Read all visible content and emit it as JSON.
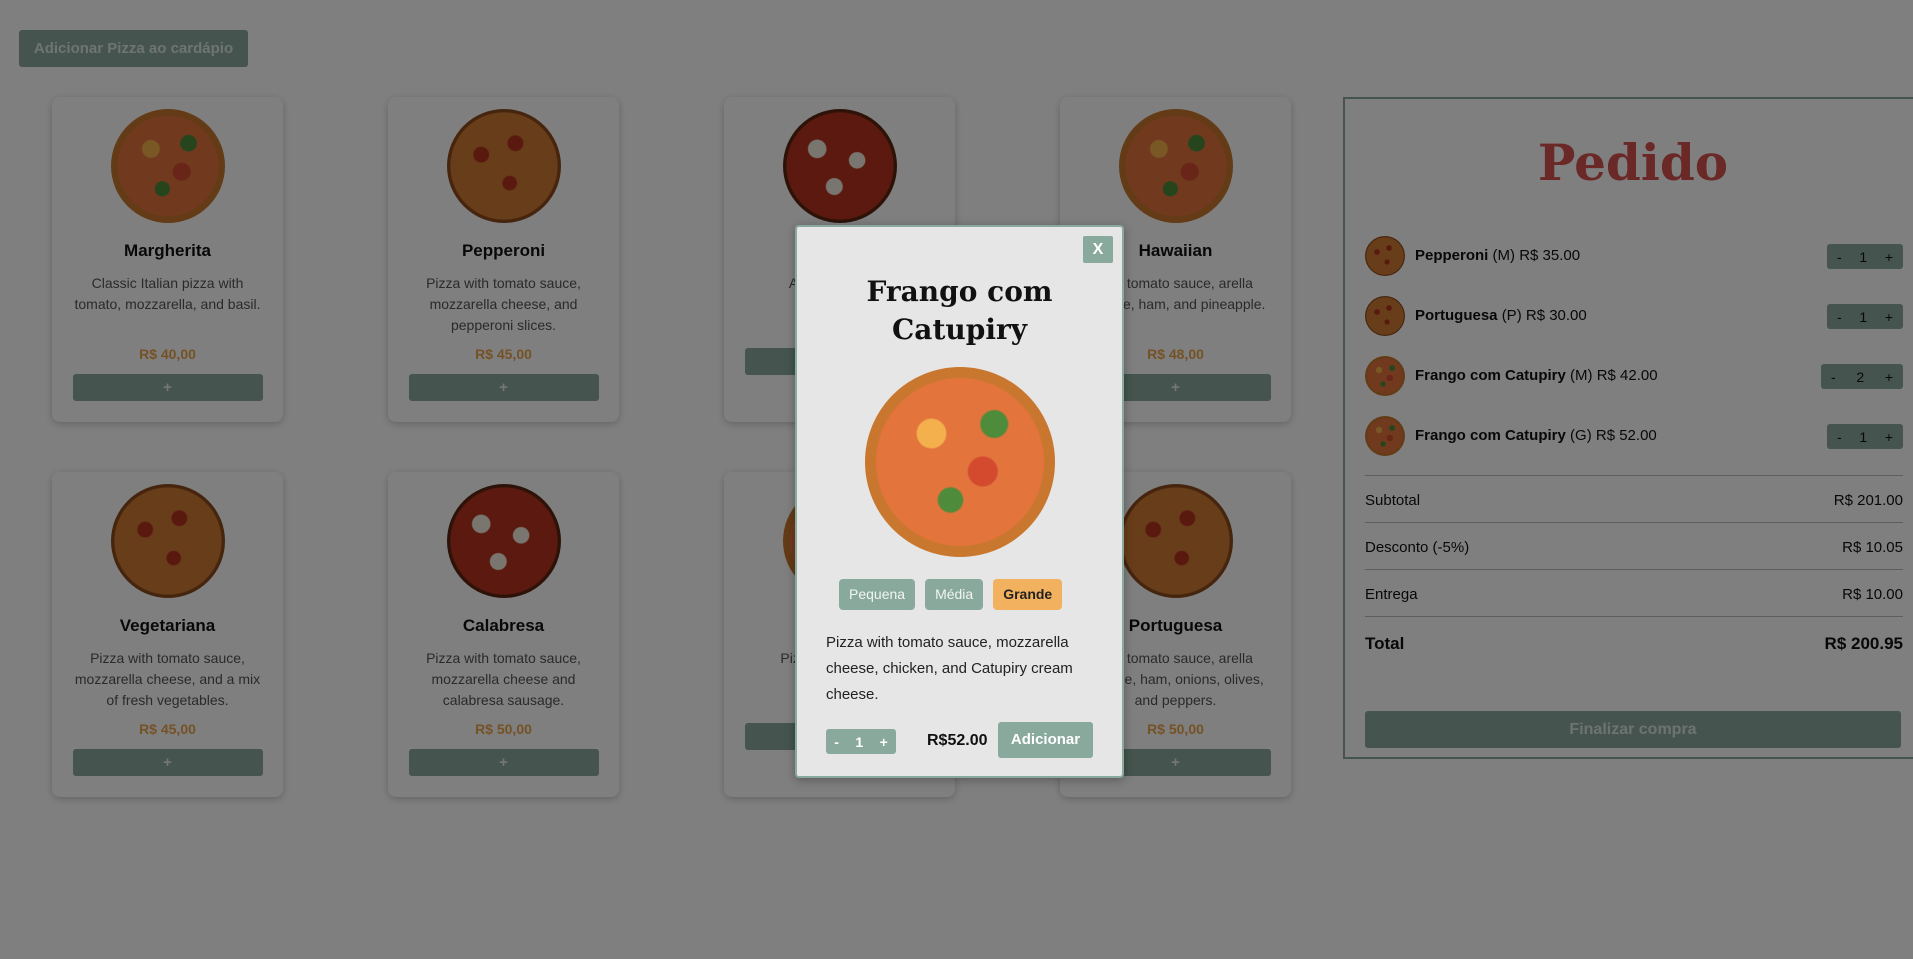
{
  "toolbar": {
    "add_pizza_label": "Adicionar Pizza ao cardápio"
  },
  "menu": [
    {
      "name": "Margherita",
      "desc": "Classic Italian pizza with tomato, mozzarella, and basil.",
      "price": "R$ 40,00",
      "add": "+"
    },
    {
      "name": "Pepperoni",
      "desc": "Pizza with tomato sauce, mozzarella cheese, and pepperoni slices.",
      "price": "R$ 45,00",
      "add": "+"
    },
    {
      "name": "Qua",
      "desc": "A co che parm a",
      "price": "",
      "add": "+"
    },
    {
      "name": "Hawaiian",
      "desc": "with tomato sauce, arella cheese, ham, and pineapple.",
      "price": "R$ 48,00",
      "add": "+"
    },
    {
      "name": "Vegetariana",
      "desc": "Pizza with tomato sauce, mozzarella cheese, and a mix of fresh vegetables.",
      "price": "R$ 45,00",
      "add": "+"
    },
    {
      "name": "Calabresa",
      "desc": "Pizza with tomato sauce, mozzarella cheese and calabresa sausage.",
      "price": "R$ 50,00",
      "add": "+"
    },
    {
      "name": "Frang",
      "desc": "Pizza w mo chick c",
      "price": "",
      "add": "+"
    },
    {
      "name": "Portuguesa",
      "desc": "with tomato sauce, arella cheese, ham, onions, olives, and peppers.",
      "price": "R$ 50,00",
      "add": "+"
    }
  ],
  "order": {
    "title": "Pedido",
    "items": [
      {
        "name": "Pepperoni",
        "size": "(M)",
        "price": "R$ 35.00",
        "qty": "1",
        "minus": "-",
        "plus": "+"
      },
      {
        "name": "Portuguesa",
        "size": "(P)",
        "price": "R$ 30.00",
        "qty": "1",
        "minus": "-",
        "plus": "+"
      },
      {
        "name": "Frango com Catupiry",
        "size": "(M)",
        "price": "R$ 42.00",
        "qty": "2",
        "minus": "-",
        "plus": "+"
      },
      {
        "name": "Frango com Catupiry",
        "size": "(G)",
        "price": "R$ 52.00",
        "qty": "1",
        "minus": "-",
        "plus": "+"
      }
    ],
    "subtotal_label": "Subtotal",
    "subtotal": "R$ 201.00",
    "discount_label": "Desconto (-5%)",
    "discount": "R$ 10.05",
    "delivery_label": "Entrega",
    "delivery": "R$ 10.00",
    "total_label": "Total",
    "total": "R$ 200.95",
    "finalize": "Finalizar compra"
  },
  "modal": {
    "close": "X",
    "title": "Frango com Catupiry",
    "sizes": [
      "Pequena",
      "Média",
      "Grande"
    ],
    "selected_size": "Grande",
    "desc": "Pizza with tomato sauce, mozzarella cheese, chicken, and Catupiry cream cheese.",
    "qty": "1",
    "minus": "-",
    "plus": "+",
    "price": "R$52.00",
    "add": "Adicionar"
  },
  "colors": {
    "accent": "#8aa99d",
    "price": "#e8a44b",
    "title": "#d4504c",
    "selected": "#f2b15f"
  }
}
